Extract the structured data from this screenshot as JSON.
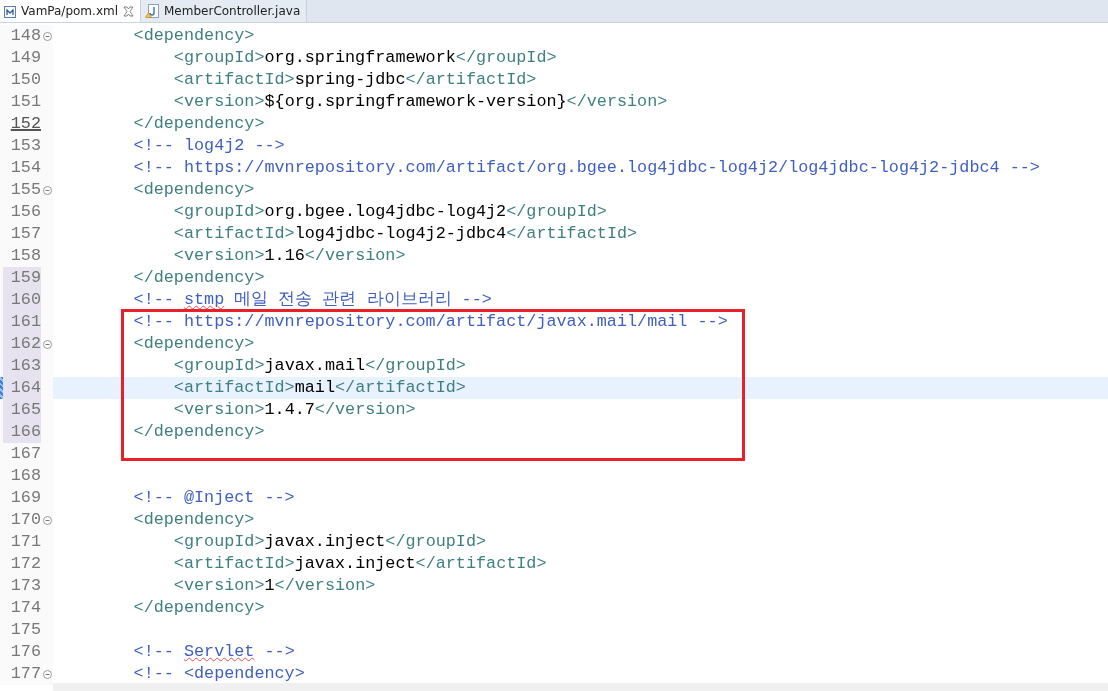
{
  "tabs": [
    {
      "label": "VamPa/pom.xml",
      "selected": true,
      "kind": "xml"
    },
    {
      "label": "MemberController.java",
      "selected": false,
      "kind": "java"
    }
  ],
  "editor": {
    "lines": [
      {
        "number": "148",
        "fold": true,
        "current": false,
        "changed": false,
        "underlined": false,
        "boxed": false,
        "tokens": [
          {
            "kind": "tag",
            "text": "        <dependency>"
          }
        ]
      },
      {
        "number": "149",
        "fold": false,
        "current": false,
        "changed": false,
        "underlined": false,
        "boxed": false,
        "tokens": [
          {
            "kind": "tag",
            "text": "            <groupId>"
          },
          {
            "kind": "text",
            "text": "org.springframework"
          },
          {
            "kind": "tag",
            "text": "</groupId>"
          }
        ]
      },
      {
        "number": "150",
        "fold": false,
        "current": false,
        "changed": false,
        "underlined": false,
        "boxed": false,
        "tokens": [
          {
            "kind": "tag",
            "text": "            <artifactId>"
          },
          {
            "kind": "text",
            "text": "spring-jdbc"
          },
          {
            "kind": "tag",
            "text": "</artifactId>"
          }
        ]
      },
      {
        "number": "151",
        "fold": false,
        "current": false,
        "changed": false,
        "underlined": false,
        "boxed": false,
        "tokens": [
          {
            "kind": "tag",
            "text": "            <version>"
          },
          {
            "kind": "text",
            "text": "${org.springframework-version}"
          },
          {
            "kind": "tag",
            "text": "</version>"
          }
        ]
      },
      {
        "number": "152",
        "fold": false,
        "current": false,
        "changed": false,
        "underlined": true,
        "boxed": false,
        "tokens": [
          {
            "kind": "tag",
            "text": "        </dependency>"
          }
        ]
      },
      {
        "number": "153",
        "fold": false,
        "current": false,
        "changed": false,
        "underlined": false,
        "boxed": false,
        "tokens": [
          {
            "kind": "comment",
            "text": "        <!-- log4j2 -->"
          }
        ]
      },
      {
        "number": "154",
        "fold": false,
        "current": false,
        "changed": false,
        "underlined": false,
        "boxed": false,
        "tokens": [
          {
            "kind": "comment",
            "text": "        <!-- https://mvnrepository.com/artifact/org.bgee.log4jdbc-log4j2/log4jdbc-log4j2-jdbc4 -->"
          }
        ]
      },
      {
        "number": "155",
        "fold": true,
        "current": false,
        "changed": false,
        "underlined": false,
        "boxed": false,
        "tokens": [
          {
            "kind": "tag",
            "text": "        <dependency>"
          }
        ]
      },
      {
        "number": "156",
        "fold": false,
        "current": false,
        "changed": false,
        "underlined": false,
        "boxed": false,
        "tokens": [
          {
            "kind": "tag",
            "text": "            <groupId>"
          },
          {
            "kind": "text",
            "text": "org.bgee.log4jdbc-log4j2"
          },
          {
            "kind": "tag",
            "text": "</groupId>"
          }
        ]
      },
      {
        "number": "157",
        "fold": false,
        "current": false,
        "changed": false,
        "underlined": false,
        "boxed": false,
        "tokens": [
          {
            "kind": "tag",
            "text": "            <artifactId>"
          },
          {
            "kind": "text",
            "text": "log4jdbc-log4j2-jdbc4"
          },
          {
            "kind": "tag",
            "text": "</artifactId>"
          }
        ]
      },
      {
        "number": "158",
        "fold": false,
        "current": false,
        "changed": false,
        "underlined": false,
        "boxed": false,
        "tokens": [
          {
            "kind": "tag",
            "text": "            <version>"
          },
          {
            "kind": "text",
            "text": "1.16"
          },
          {
            "kind": "tag",
            "text": "</version>"
          }
        ]
      },
      {
        "number": "159",
        "fold": false,
        "current": false,
        "changed": true,
        "underlined": false,
        "boxed": false,
        "tokens": [
          {
            "kind": "tag",
            "text": "        </dependency>"
          }
        ]
      },
      {
        "number": "160",
        "fold": false,
        "current": false,
        "changed": true,
        "underlined": false,
        "boxed": false,
        "tokens": [
          {
            "kind": "comment",
            "text": "        <!-- "
          },
          {
            "kind": "misspelled",
            "text": "stmp"
          },
          {
            "kind": "comment",
            "text": " 메일 전송 관련 라이브러리 -->"
          }
        ]
      },
      {
        "number": "161",
        "fold": false,
        "current": false,
        "changed": true,
        "underlined": false,
        "boxed": true,
        "tokens": [
          {
            "kind": "comment",
            "text": "        <!-- https://mvnrepository.com/artifact/javax.mail/mail -->"
          }
        ]
      },
      {
        "number": "162",
        "fold": true,
        "current": false,
        "changed": true,
        "underlined": false,
        "boxed": true,
        "tokens": [
          {
            "kind": "tag",
            "text": "        <dependency>"
          }
        ]
      },
      {
        "number": "163",
        "fold": false,
        "current": false,
        "changed": true,
        "underlined": false,
        "boxed": true,
        "tokens": [
          {
            "kind": "tag",
            "text": "            <groupId>"
          },
          {
            "kind": "text",
            "text": "javax.mail"
          },
          {
            "kind": "tag",
            "text": "</groupId>"
          }
        ]
      },
      {
        "number": "164",
        "fold": false,
        "current": true,
        "changed": true,
        "underlined": false,
        "boxed": true,
        "tokens": [
          {
            "kind": "tag",
            "text": "            <artifactId>"
          },
          {
            "kind": "text",
            "text": "mail"
          },
          {
            "kind": "tag",
            "text": "</artifactId>"
          }
        ]
      },
      {
        "number": "165",
        "fold": false,
        "current": false,
        "changed": true,
        "underlined": false,
        "boxed": true,
        "tokens": [
          {
            "kind": "tag",
            "text": "            <version>"
          },
          {
            "kind": "text",
            "text": "1.4.7"
          },
          {
            "kind": "tag",
            "text": "</version>"
          }
        ]
      },
      {
        "number": "166",
        "fold": false,
        "current": false,
        "changed": true,
        "underlined": false,
        "boxed": true,
        "tokens": [
          {
            "kind": "tag",
            "text": "        </dependency>"
          }
        ]
      },
      {
        "number": "167",
        "fold": false,
        "current": false,
        "changed": false,
        "underlined": false,
        "boxed": false
      },
      {
        "number": "168",
        "fold": false,
        "current": false,
        "changed": false,
        "underlined": false,
        "boxed": false
      },
      {
        "number": "169",
        "fold": false,
        "current": false,
        "changed": false,
        "underlined": false,
        "boxed": false,
        "tokens": [
          {
            "kind": "comment",
            "text": "        <!-- @Inject -->"
          }
        ]
      },
      {
        "number": "170",
        "fold": true,
        "current": false,
        "changed": false,
        "underlined": false,
        "boxed": false,
        "tokens": [
          {
            "kind": "tag",
            "text": "        <dependency>"
          }
        ]
      },
      {
        "number": "171",
        "fold": false,
        "current": false,
        "changed": false,
        "underlined": false,
        "boxed": false,
        "tokens": [
          {
            "kind": "tag",
            "text": "            <groupId>"
          },
          {
            "kind": "text",
            "text": "javax.inject"
          },
          {
            "kind": "tag",
            "text": "</groupId>"
          }
        ]
      },
      {
        "number": "172",
        "fold": false,
        "current": false,
        "changed": false,
        "underlined": false,
        "boxed": false,
        "tokens": [
          {
            "kind": "tag",
            "text": "            <artifactId>"
          },
          {
            "kind": "text",
            "text": "javax.inject"
          },
          {
            "kind": "tag",
            "text": "</artifactId>"
          }
        ]
      },
      {
        "number": "173",
        "fold": false,
        "current": false,
        "changed": false,
        "underlined": false,
        "boxed": false,
        "tokens": [
          {
            "kind": "tag",
            "text": "            <version>"
          },
          {
            "kind": "text",
            "text": "1"
          },
          {
            "kind": "tag",
            "text": "</version>"
          }
        ]
      },
      {
        "number": "174",
        "fold": false,
        "current": false,
        "changed": false,
        "underlined": false,
        "boxed": false,
        "tokens": [
          {
            "kind": "tag",
            "text": "        </dependency>"
          }
        ]
      },
      {
        "number": "175",
        "fold": false,
        "current": false,
        "changed": false,
        "underlined": false,
        "boxed": false
      },
      {
        "number": "176",
        "fold": false,
        "current": false,
        "changed": false,
        "underlined": false,
        "boxed": false,
        "tokens": [
          {
            "kind": "comment",
            "text": "        <!-- "
          },
          {
            "kind": "misspelled",
            "text": "Servlet"
          },
          {
            "kind": "comment",
            "text": " -->"
          }
        ]
      },
      {
        "number": "177",
        "fold": true,
        "current": false,
        "changed": false,
        "underlined": false,
        "boxed": false,
        "tokens": [
          {
            "kind": "comment",
            "text": "        <!-- <dependency>"
          }
        ]
      }
    ]
  }
}
